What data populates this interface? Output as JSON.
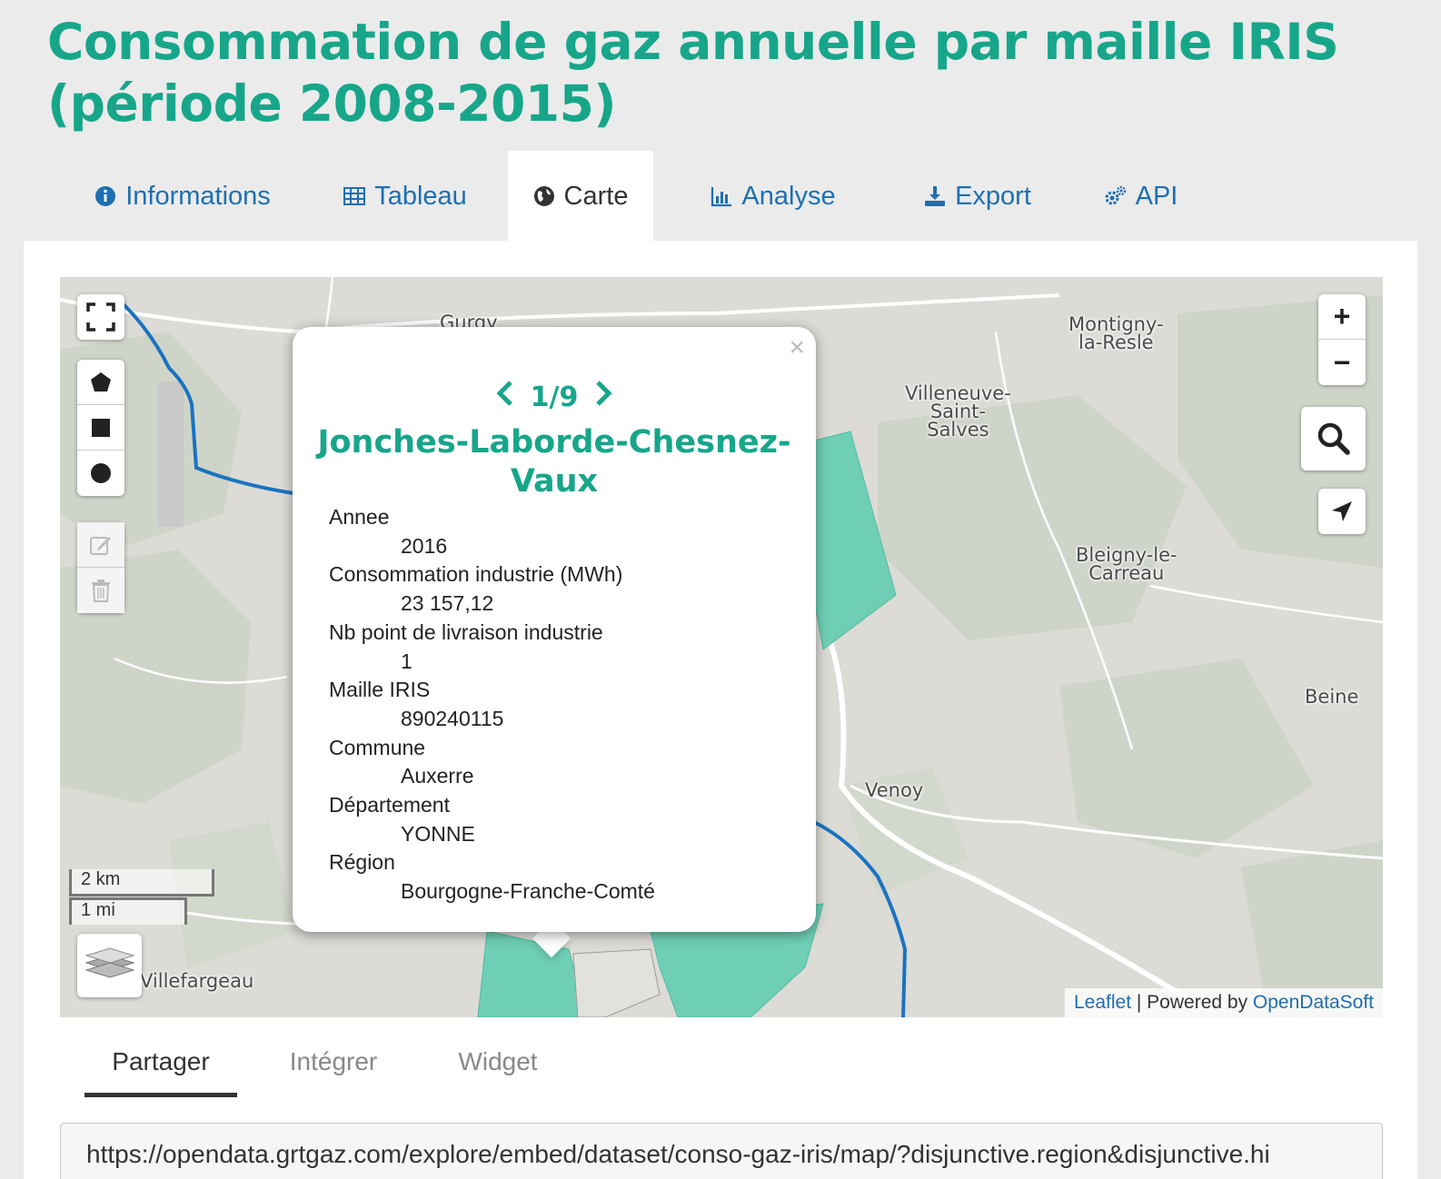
{
  "page": {
    "title": "Consommation de gaz annuelle par maille IRIS (période 2008-2015)"
  },
  "tabs": [
    {
      "label": "Informations",
      "icon": "info-circle-icon"
    },
    {
      "label": "Tableau",
      "icon": "table-icon"
    },
    {
      "label": "Carte",
      "icon": "globe-icon",
      "active": true
    },
    {
      "label": "Analyse",
      "icon": "bar-chart-icon"
    },
    {
      "label": "Export",
      "icon": "download-icon"
    },
    {
      "label": "API",
      "icon": "gears-icon"
    }
  ],
  "map": {
    "places": {
      "guray": "Gurgy",
      "montigny": "Montigny-\nla-Resle",
      "villeneuve": "Villeneuve-\nSaint-\nSalves",
      "bleigny": "Bleigny-le-\nCarreau",
      "beine": "Beine",
      "venoy": "Venoy",
      "villefargeau": "Villefargeau"
    },
    "controls": {
      "zoom_in": "+",
      "zoom_out": "−"
    },
    "scale": {
      "km": "2 km",
      "mi": "1 mi"
    },
    "attribution": {
      "leaflet": "Leaflet",
      "separator": " | Powered by ",
      "ods": "OpenDataSoft"
    },
    "colors": {
      "highlight": "#6fcfb5",
      "river": "#1a73c0",
      "accent": "#17a68a",
      "link": "#1e6fb0"
    }
  },
  "popup": {
    "pager": "1/9",
    "title": "Jonches-Laborde-Chesnez-Vaux",
    "close": "×",
    "fields": [
      {
        "label": "Annee",
        "value": "2016"
      },
      {
        "label": "Consommation industrie (MWh)",
        "value": "23 157,12"
      },
      {
        "label": "Nb point de livraison industrie",
        "value": "1"
      },
      {
        "label": "Maille IRIS",
        "value": "890240115"
      },
      {
        "label": "Commune",
        "value": "Auxerre"
      },
      {
        "label": "Département",
        "value": "YONNE"
      },
      {
        "label": "Région",
        "value": "Bourgogne-Franche-Comté"
      }
    ]
  },
  "share": {
    "tabs": [
      {
        "label": "Partager",
        "active": true
      },
      {
        "label": "Intégrer"
      },
      {
        "label": "Widget"
      }
    ],
    "url": "https://opendata.grtgaz.com/explore/embed/dataset/conso-gaz-iris/map/?disjunctive.region&disjunctive.hi"
  }
}
